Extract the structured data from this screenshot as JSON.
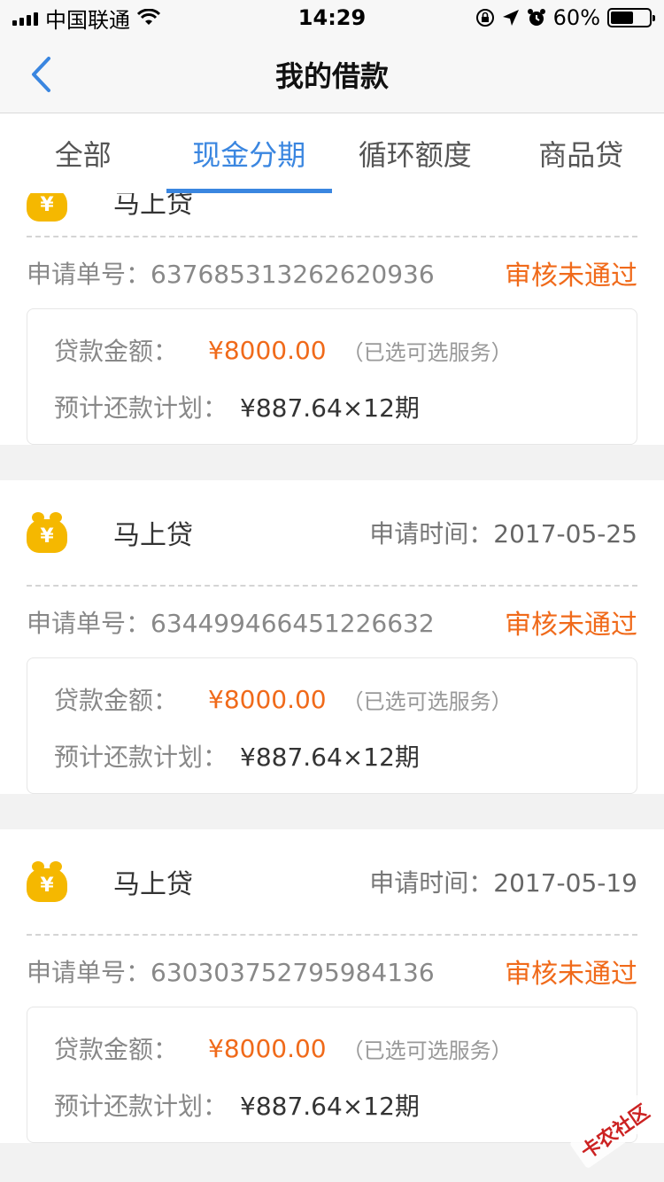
{
  "status_bar": {
    "carrier": "中国联通",
    "time": "14:29",
    "battery": "60%",
    "battery_level": 0.6
  },
  "nav": {
    "title": "我的借款"
  },
  "tabs": [
    {
      "label": "全部",
      "active": false
    },
    {
      "label": "现金分期",
      "active": true
    },
    {
      "label": "循环额度",
      "active": false
    },
    {
      "label": "商品贷",
      "active": false
    }
  ],
  "labels": {
    "order_no": "申请单号：",
    "apply_time": "申请时间：",
    "amount": "贷款金额：",
    "plan": "预计还款计划：",
    "note": "（已选可选服务）"
  },
  "loans": [
    {
      "lender": "马上贷",
      "apply_date": "",
      "order_no": "637685313262620936",
      "status": "审核未通过",
      "amount": "¥8000.00",
      "plan": "¥887.64×12期"
    },
    {
      "lender": "马上贷",
      "apply_date": "2017-05-25",
      "order_no": "634499466451226632",
      "status": "审核未通过",
      "amount": "¥8000.00",
      "plan": "¥887.64×12期"
    },
    {
      "lender": "马上贷",
      "apply_date": "2017-05-19",
      "order_no": "630303752795984136",
      "status": "审核未通过",
      "amount": "¥8000.00",
      "plan": "¥887.64×12期"
    }
  ],
  "watermark": "卡农社区",
  "icons": {
    "back": "chevron-left-icon",
    "wifi": "wifi-icon",
    "lock": "rotation-lock-icon",
    "location": "location-arrow-icon",
    "alarm": "alarm-icon",
    "bag": "money-bag-icon"
  },
  "colors": {
    "accent": "#3a86e0",
    "status": "#f06a1a",
    "bag": "#f5b800"
  }
}
